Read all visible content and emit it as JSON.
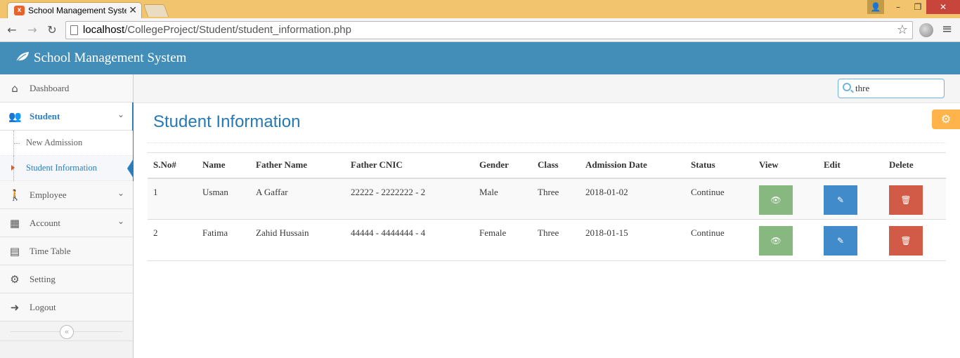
{
  "browser": {
    "tab_title": "School Management Syste",
    "favicon_letter": "x",
    "url_host": "localhost",
    "url_path": "/CollegeProject/Student/student_information.php"
  },
  "app": {
    "title": "School Management System"
  },
  "sidebar": {
    "items": [
      {
        "label": "Dashboard",
        "icon": "home-icon"
      },
      {
        "label": "Student",
        "icon": "users-icon"
      },
      {
        "label": "Employee",
        "icon": "person-icon"
      },
      {
        "label": "Account",
        "icon": "calculator-icon"
      },
      {
        "label": "Time Table",
        "icon": "calendar-icon"
      },
      {
        "label": "Setting",
        "icon": "gear-icon"
      },
      {
        "label": "Logout",
        "icon": "logout-icon"
      }
    ],
    "student_sub": [
      {
        "label": "New Admission"
      },
      {
        "label": "Student Information"
      }
    ]
  },
  "search": {
    "value": "thre"
  },
  "page": {
    "title": "Student Information"
  },
  "table": {
    "headers": [
      "S.No#",
      "Name",
      "Father Name",
      "Father CNIC",
      "Gender",
      "Class",
      "Admission Date",
      "Status",
      "View",
      "Edit",
      "Delete"
    ],
    "rows": [
      {
        "sno": "1",
        "name": "Usman",
        "father": "A Gaffar",
        "cnic": "22222 - 2222222 - 2",
        "gender": "Male",
        "class": "Three",
        "date": "2018-01-02",
        "status": "Continue"
      },
      {
        "sno": "2",
        "name": "Fatima",
        "father": "Zahid Hussain",
        "cnic": "44444 - 4444444 - 4",
        "gender": "Female",
        "class": "Three",
        "date": "2018-01-15",
        "status": "Continue"
      }
    ]
  },
  "colors": {
    "header": "#438eb9",
    "accent": "#2b7dbc",
    "view": "#87b87f",
    "edit": "#428bca",
    "delete": "#d15b47",
    "settings": "#ffb44b"
  }
}
